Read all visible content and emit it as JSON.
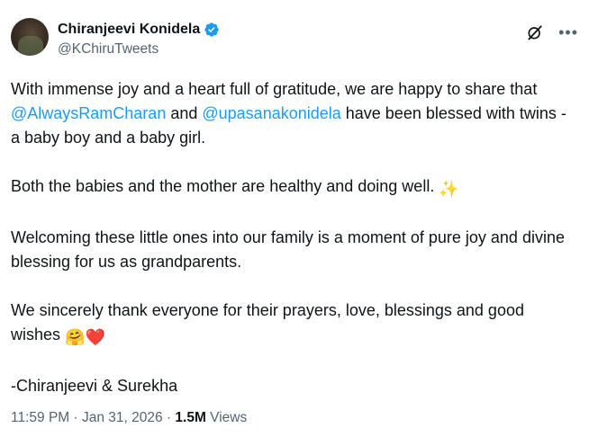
{
  "author": {
    "display_name": "Chiranjeevi Konidela",
    "handle": "@KChiruTweets",
    "verified_color": "#1d9bf0"
  },
  "icons": {
    "grok": "grok-icon",
    "more": "more-icon",
    "verified": "verified-badge-icon"
  },
  "tweet": {
    "p1_a": "With immense joy and a heart full of gratitude, we are happy to share that ",
    "mention1": "@AlwaysRamCharan",
    "p1_b": " and ",
    "mention2": "@upasanakonidela",
    "p1_c": " have been blessed with twins - a baby boy and a baby girl.",
    "p2": "Both the babies and the mother are healthy and doing well. ",
    "p2_emoji": "✨",
    "p3": "Welcoming these little ones into our family is a moment of pure joy and divine blessing for us as grandparents.",
    "p4": "We sincerely thank everyone for their prayers, love, blessings and good wishes ",
    "p4_emoji": "🤗❤️",
    "signature": "-Chiranjeevi & Surekha"
  },
  "meta": {
    "time": "11:59 PM",
    "sep": " · ",
    "date": "Jan 31, 2026",
    "sep2": " · ",
    "views_count": "1.5M",
    "views_label": " Views"
  }
}
